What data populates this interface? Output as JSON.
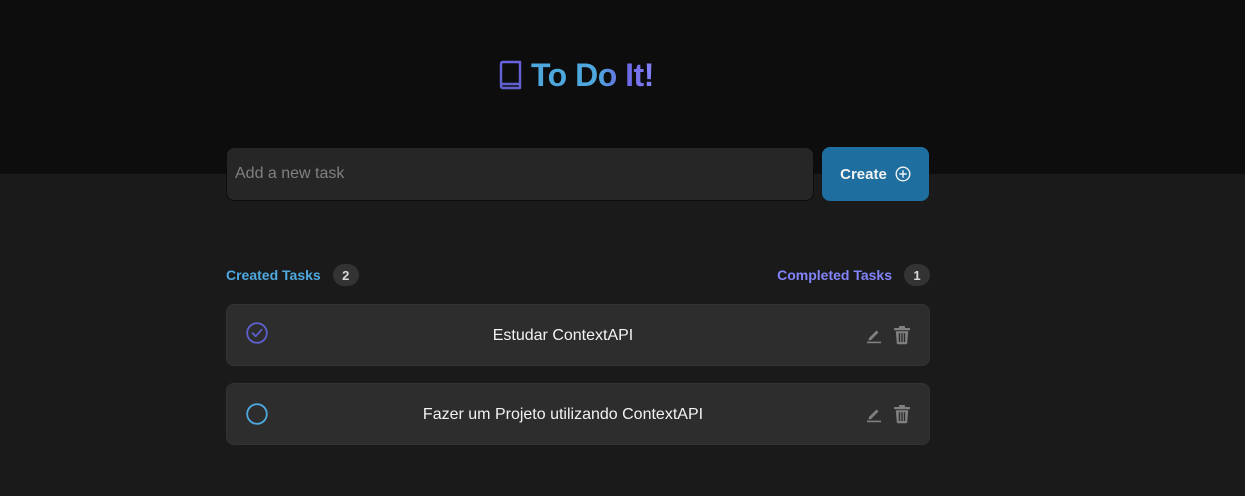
{
  "app": {
    "title": "To Do It!",
    "brand_icon": "book-icon",
    "colors": {
      "header_bg": "#0d0d0d",
      "page_bg": "#1a1a1a",
      "blue": "#4ea8de",
      "purple": "#8284fa",
      "button_bg": "#1e6f9f"
    }
  },
  "new_task": {
    "placeholder": "Add a new task",
    "value": "",
    "button_label": "Create",
    "button_icon": "plus-circle-icon"
  },
  "summary": {
    "created_label": "Created Tasks",
    "created_count": "2",
    "completed_label": "Completed Tasks",
    "completed_count": "1"
  },
  "tasks": [
    {
      "text": "Estudar ContextAPI",
      "completed": true,
      "edit_icon": "pencil-icon",
      "delete_icon": "trash-icon"
    },
    {
      "text": "Fazer um Projeto utilizando ContextAPI",
      "completed": false,
      "edit_icon": "pencil-icon",
      "delete_icon": "trash-icon"
    }
  ]
}
